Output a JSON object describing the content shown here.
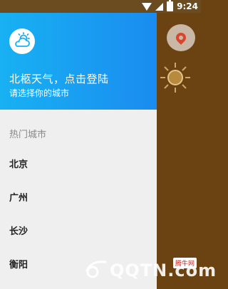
{
  "status_bar": {
    "time": "9:24"
  },
  "drawer": {
    "header": {
      "title": "北柩天气，点击登陆",
      "subtitle": "请选择你的城市"
    },
    "section_title": "热门城市",
    "cities": [
      "北京",
      "广州",
      "长沙",
      "衡阳"
    ]
  },
  "watermark": {
    "text": "QQTN.com",
    "badge": "腾牛网"
  },
  "icons": {
    "avatar": "weather-cloud-sun-icon",
    "location": "location-pin-icon",
    "background_weather": "sun-icon"
  },
  "colors": {
    "header_blue": "#1a9ef2",
    "background_brown": "#6b4312",
    "drawer_bg": "#efefef"
  }
}
